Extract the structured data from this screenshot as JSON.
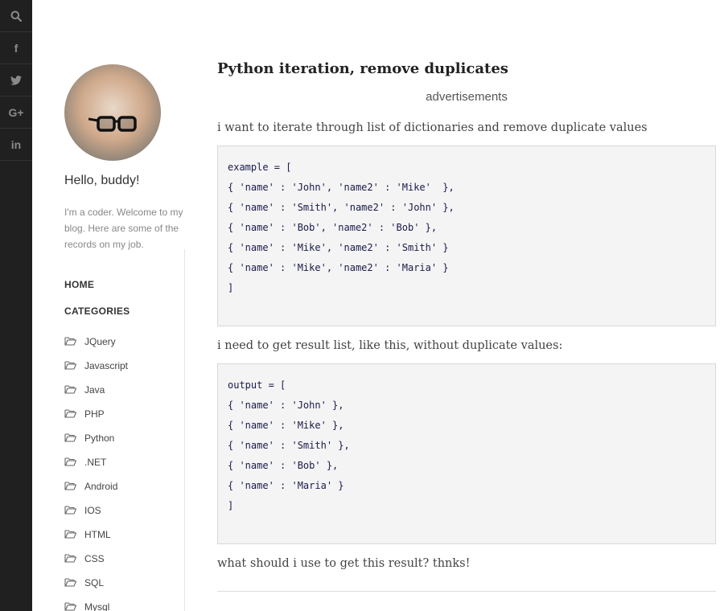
{
  "social": [
    {
      "name": "search-icon"
    },
    {
      "name": "facebook-icon",
      "glyph": "f"
    },
    {
      "name": "twitter-icon"
    },
    {
      "name": "google-plus-icon",
      "glyph": "G+"
    },
    {
      "name": "linkedin-icon",
      "glyph": "in"
    }
  ],
  "profile": {
    "greeting": "Hello, buddy!",
    "intro": "I'm a coder. Welcome to my blog. Here are some of the records on my job."
  },
  "nav": {
    "home": "HOME",
    "categories": "CATEGORIES",
    "items": [
      "JQuery",
      "Javascript",
      "Java",
      "PHP",
      "Python",
      ".NET",
      "Android",
      "IOS",
      "HTML",
      "CSS",
      "SQL",
      "Mysql"
    ]
  },
  "post": {
    "title": "Python iteration, remove duplicates",
    "ads": "advertisements",
    "p1": "i want to iterate through list of dictionaries and remove duplicate values",
    "code1": [
      "example = [",
      "{ 'name' : 'John', 'name2' : 'Mike'  },",
      "{ 'name' : 'Smith', 'name2' : 'John' },",
      "{ 'name' : 'Bob', 'name2' : 'Bob' },",
      "{ 'name' : 'Mike', 'name2' : 'Smith' }",
      "{ 'name' : 'Mike', 'name2' : 'Maria' }",
      "]"
    ],
    "p2": "i need to get result list, like this, without duplicate values:",
    "code2": [
      "output = [",
      "{ 'name' : 'John' },",
      "{ 'name' : 'Mike' },",
      "{ 'name' : 'Smith' },",
      "{ 'name' : 'Bob' },",
      "{ 'name' : 'Maria' }",
      "]"
    ],
    "p3": "what should i use to get this result? thnks!"
  }
}
